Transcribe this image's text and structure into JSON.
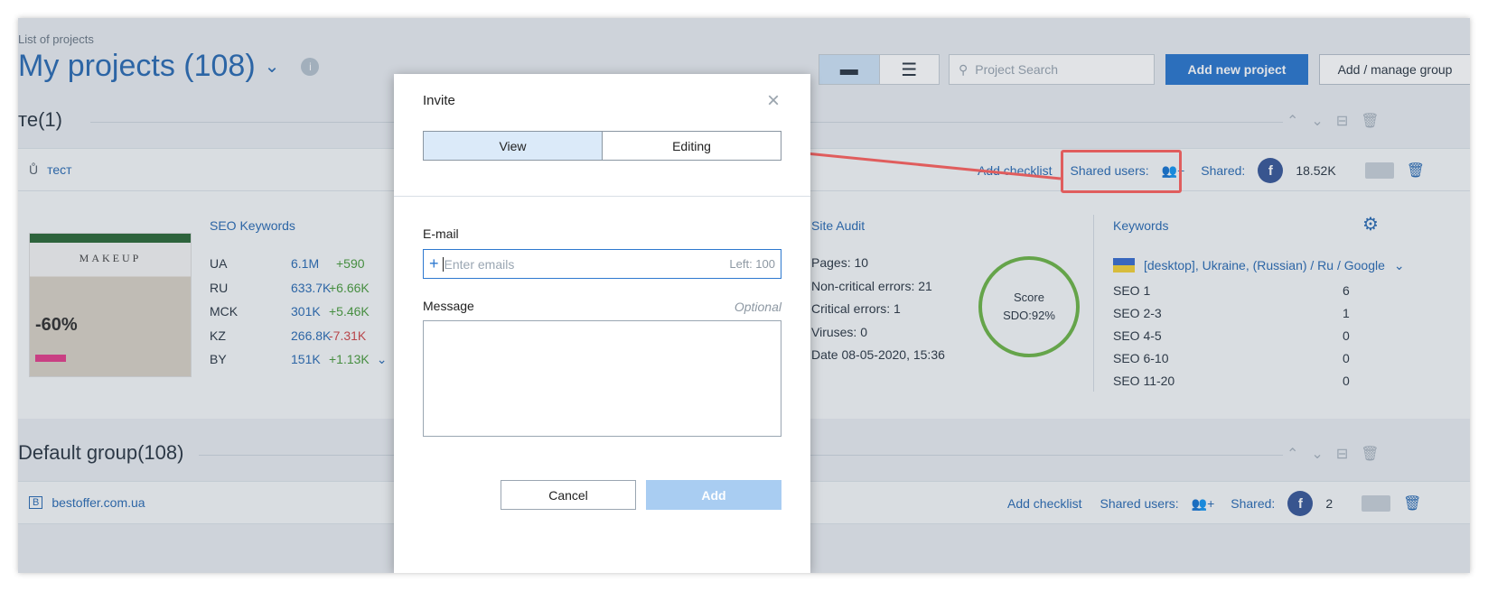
{
  "header": {
    "breadcrumb": "List of projects",
    "title": "My projects (108)",
    "search_placeholder": "Project Search",
    "add_project": "Add new project",
    "manage_group": "Add / manage group"
  },
  "groups": [
    {
      "title": "те(1)",
      "project": {
        "icon": "Ů",
        "name": "тест",
        "add_checklist": "Add checklist",
        "shared_users": "Shared users:",
        "shared": "Shared:",
        "shared_count": "18.52K"
      }
    },
    {
      "title": "Default group(108)",
      "project": {
        "icon": "B",
        "name": "bestoffer.com.ua",
        "add_checklist": "Add checklist",
        "shared_users": "Shared users:",
        "shared": "Shared:",
        "shared_count": "2"
      }
    }
  ],
  "seo_keywords": {
    "title": "SEO Keywords",
    "rows": [
      {
        "region": "UA",
        "value": "6.1M",
        "delta": "+590"
      },
      {
        "region": "RU",
        "value": "633.7K",
        "delta": "+6.66K"
      },
      {
        "region": "MCK",
        "value": "301K",
        "delta": "+5.46K"
      },
      {
        "region": "KZ",
        "value": "266.8K",
        "delta": "-7.31K"
      },
      {
        "region": "BY",
        "value": "151K",
        "delta": "+1.13K"
      }
    ]
  },
  "thumbnail": {
    "logo": "MAKEUP",
    "sale": "-60%"
  },
  "site_audit": {
    "title": "Site Audit",
    "pages_label": "Pages:",
    "pages": "10",
    "noncrit_label": "Non-critical errors:",
    "noncrit": "21",
    "crit_label": "Critical errors:",
    "crit": "1",
    "viruses_label": "Viruses:",
    "viruses": "0",
    "date_label": "Date",
    "date": "08-05-2020, 15:36",
    "score_label": "Score",
    "score_value": "SDO:92%"
  },
  "keywords": {
    "title": "Keywords",
    "geo": "[desktop], Ukraine, (Russian) / Ru / Google",
    "rows": [
      {
        "label": "SEO 1",
        "value": "6"
      },
      {
        "label": "SEO 2-3",
        "value": "1"
      },
      {
        "label": "SEO 4-5",
        "value": "0"
      },
      {
        "label": "SEO 6-10",
        "value": "0"
      },
      {
        "label": "SEO 11-20",
        "value": "0"
      }
    ]
  },
  "modal": {
    "title": "Invite",
    "tab_view": "View",
    "tab_editing": "Editing",
    "email_label": "E-mail",
    "email_placeholder": "Enter emails",
    "email_left": "Left: 100",
    "message_label": "Message",
    "optional": "Optional",
    "cancel": "Cancel",
    "add": "Add"
  },
  "colors": {
    "accent": "#2d78cf",
    "highlight": "#e05d5d"
  }
}
